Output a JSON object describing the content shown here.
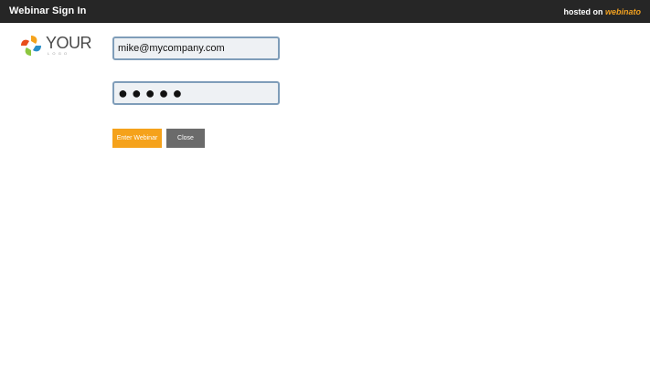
{
  "header": {
    "title": "Webinar Sign In",
    "hosted_prefix": "hosted on",
    "hosted_brand": "webinato"
  },
  "logo": {
    "text": "YOUR",
    "subtext": "LOGO"
  },
  "form": {
    "email_value": "mike@mycompany.com",
    "password_value": "●●●●●"
  },
  "buttons": {
    "enter_label": "Enter Webinar",
    "close_label": "Close"
  },
  "colors": {
    "header_bg": "#262626",
    "enter_button": "#f5a21b",
    "close_button": "#6b6b6b",
    "field_border": "#7f9db9",
    "brand_accent": "#f0a020"
  }
}
